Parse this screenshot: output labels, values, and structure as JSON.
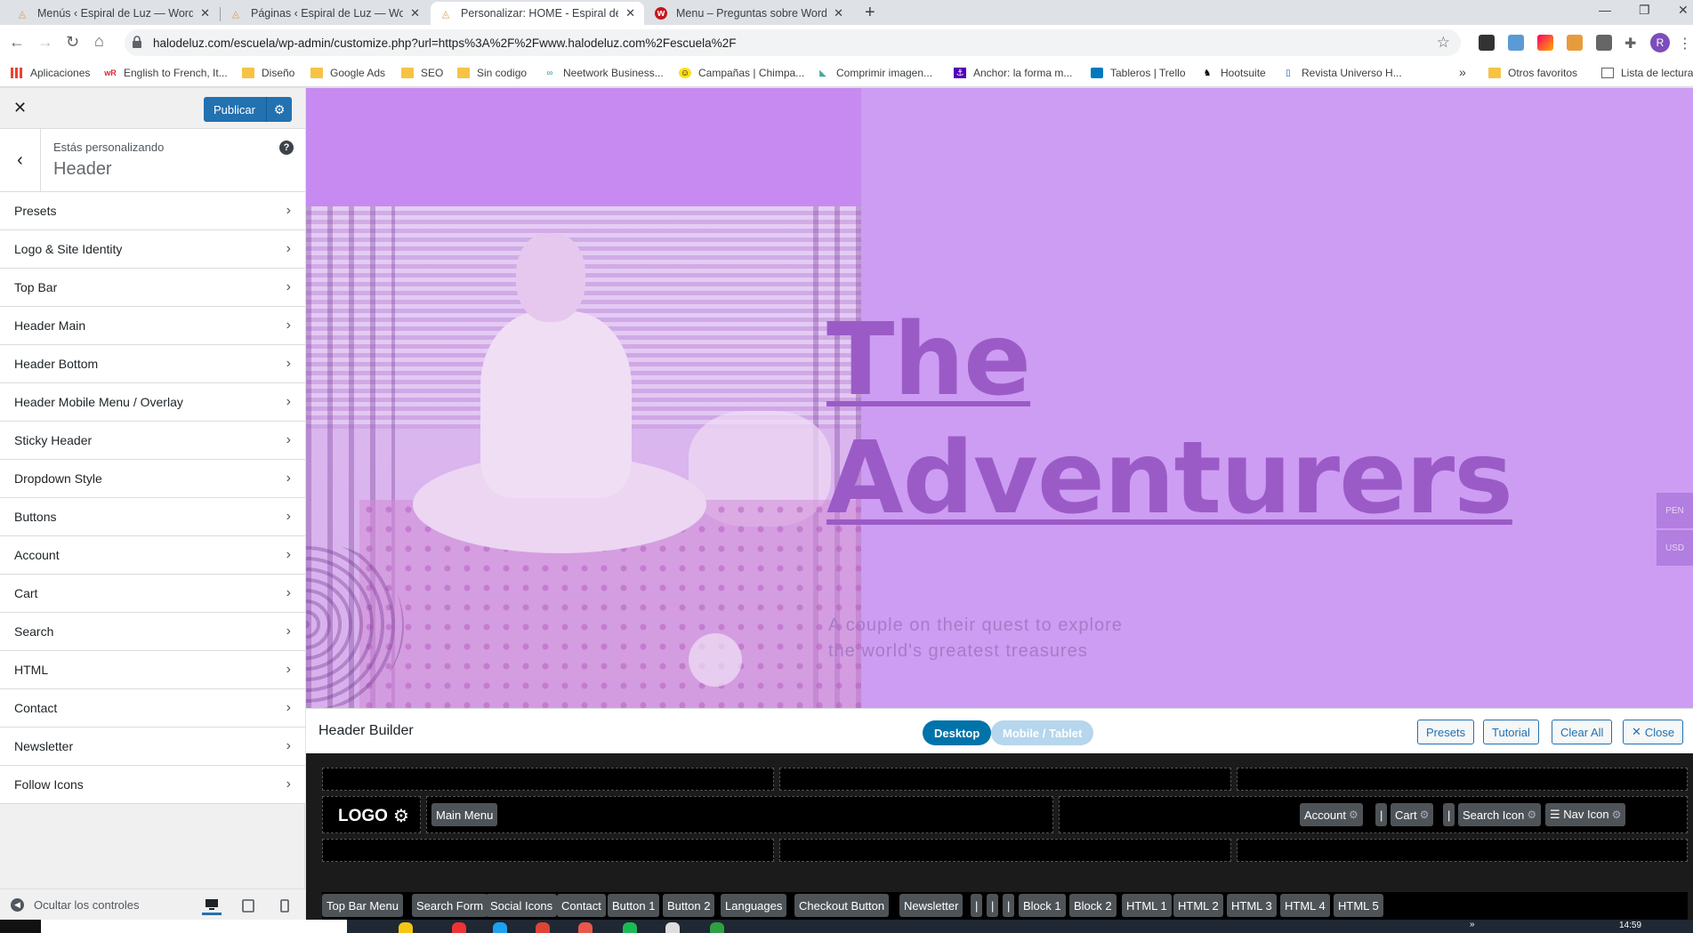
{
  "browser": {
    "tabs": [
      {
        "title": "Menús ‹ Espiral de Luz — WordPress",
        "active": false
      },
      {
        "title": "Páginas ‹ Espiral de Luz — WordPress",
        "active": false
      },
      {
        "title": "Personalizar: HOME - Espiral de Luz",
        "active": true
      },
      {
        "title": "Menu – Preguntas sobre WordPress",
        "active": false
      }
    ],
    "url": "halodeluz.com/escuela/wp-admin/customize.php?url=https%3A%2F%2Fwww.halodeluz.com%2Fescuela%2F",
    "bookmarks": [
      {
        "label": "Aplicaciones",
        "icon": "apps-grid-icon"
      },
      {
        "label": "English to French, It...",
        "icon": "wr-icon"
      },
      {
        "label": "Diseño",
        "icon": "folder-icon"
      },
      {
        "label": "Google Ads",
        "icon": "folder-icon"
      },
      {
        "label": "SEO",
        "icon": "folder-icon"
      },
      {
        "label": "Sin codigo",
        "icon": "folder-icon"
      },
      {
        "label": "Neetwork Business...",
        "icon": "neetwork-icon"
      },
      {
        "label": "Campañas | Chimpa...",
        "icon": "mailchimp-icon"
      },
      {
        "label": "Comprimir imagen...",
        "icon": "compress-icon"
      },
      {
        "label": "Anchor: la forma m...",
        "icon": "anchor-icon"
      },
      {
        "label": "Tableros | Trello",
        "icon": "trello-icon"
      },
      {
        "label": "Hootsuite",
        "icon": "hootsuite-icon"
      },
      {
        "label": "Revista Universo H...",
        "icon": "doc-icon"
      }
    ],
    "bookmarks_more": "»",
    "other_bookmarks": "Otros favoritos",
    "reading_list": "Lista de lectura",
    "profile_initial": "R"
  },
  "customizer": {
    "publish_label": "Publicar",
    "customizing_label": "Estás personalizando",
    "section_title": "Header",
    "help": "?",
    "items": [
      "Presets",
      "Logo & Site Identity",
      "Top Bar",
      "Header Main",
      "Header Bottom",
      "Header Mobile Menu / Overlay",
      "Sticky Header",
      "Dropdown Style",
      "Buttons",
      "Account",
      "Cart",
      "Search",
      "HTML",
      "Contact",
      "Newsletter",
      "Follow Icons"
    ],
    "hide_controls": "Ocultar los controles",
    "active_device": "desktop"
  },
  "preview": {
    "hero_title_line1": "The",
    "hero_title_line2": "Adventurers",
    "hero_sub_line1": "A couple on their quest to explore",
    "hero_sub_line2": "the world's greatest treasures",
    "currency_1": "PEN",
    "currency_2": "USD",
    "bg_color": "#cc9df2",
    "title_color": "#9b5bc7"
  },
  "header_builder": {
    "title": "Header Builder",
    "desktop_label": "Desktop",
    "mobile_label": "Mobile / Tablet",
    "presets_label": "Presets",
    "tutorial_label": "Tutorial",
    "clear_all_label": "Clear All",
    "close_label": "Close",
    "logo_label": "LOGO",
    "main_menu_label": "Main Menu",
    "right_elements": [
      "Account",
      "|",
      "Cart",
      "|",
      "Search Icon",
      "☰ Nav Icon"
    ],
    "available_elements": [
      "Top Bar Menu",
      "Search Form",
      "Social Icons",
      "Contact",
      "Button 1",
      "Button 2",
      "Languages",
      "Checkout Button",
      "Newsletter",
      "|",
      "|",
      "|",
      "Block 1",
      "Block 2",
      "HTML 1",
      "HTML 2",
      "HTML 3",
      "HTML 4",
      "HTML 5"
    ]
  },
  "taskbar": {
    "time": "14:59",
    "overflow": "»"
  }
}
